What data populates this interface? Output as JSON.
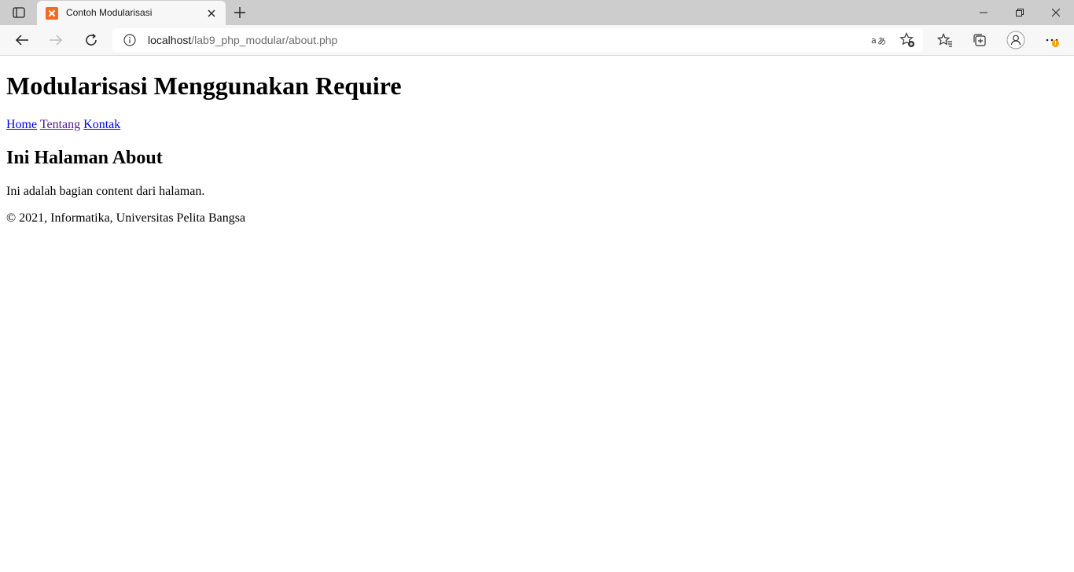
{
  "browser": {
    "tab": {
      "title": "Contoh Modularisasi",
      "favicon": "xampp-icon"
    },
    "address": {
      "host": "localhost",
      "path": "/lab9_php_modular/about.php"
    },
    "icons": {
      "tab_actions": "tab-actions-icon",
      "close_tab": "close-icon",
      "new_tab": "plus-icon",
      "minimize": "minimize-icon",
      "restore": "restore-icon",
      "close_window": "close-icon",
      "back": "arrow-left-icon",
      "forward": "arrow-right-icon",
      "refresh": "refresh-icon",
      "site_info": "info-icon",
      "translate": "translate-icon",
      "add_favorite": "star-add-icon",
      "favorites": "favorites-icon",
      "collections": "collections-icon",
      "profile": "profile-icon",
      "menu": "more-icon"
    },
    "menu_badge": "!"
  },
  "page": {
    "heading": "Modularisasi Menggunakan Require",
    "nav": [
      {
        "label": "Home"
      },
      {
        "label": "Tentang"
      },
      {
        "label": "Kontak"
      }
    ],
    "subheading": "Ini Halaman About",
    "content": "Ini adalah bagian content dari halaman.",
    "footer": "© 2021, Informatika, Universitas Pelita Bangsa"
  },
  "colors": {
    "link": "#0000ee",
    "visited_link": "#551a8b",
    "tab_strip": "#cdcdcd",
    "toolbar": "#f7f7f7",
    "favicon": "#f26b21",
    "badge": "#f5a300"
  }
}
